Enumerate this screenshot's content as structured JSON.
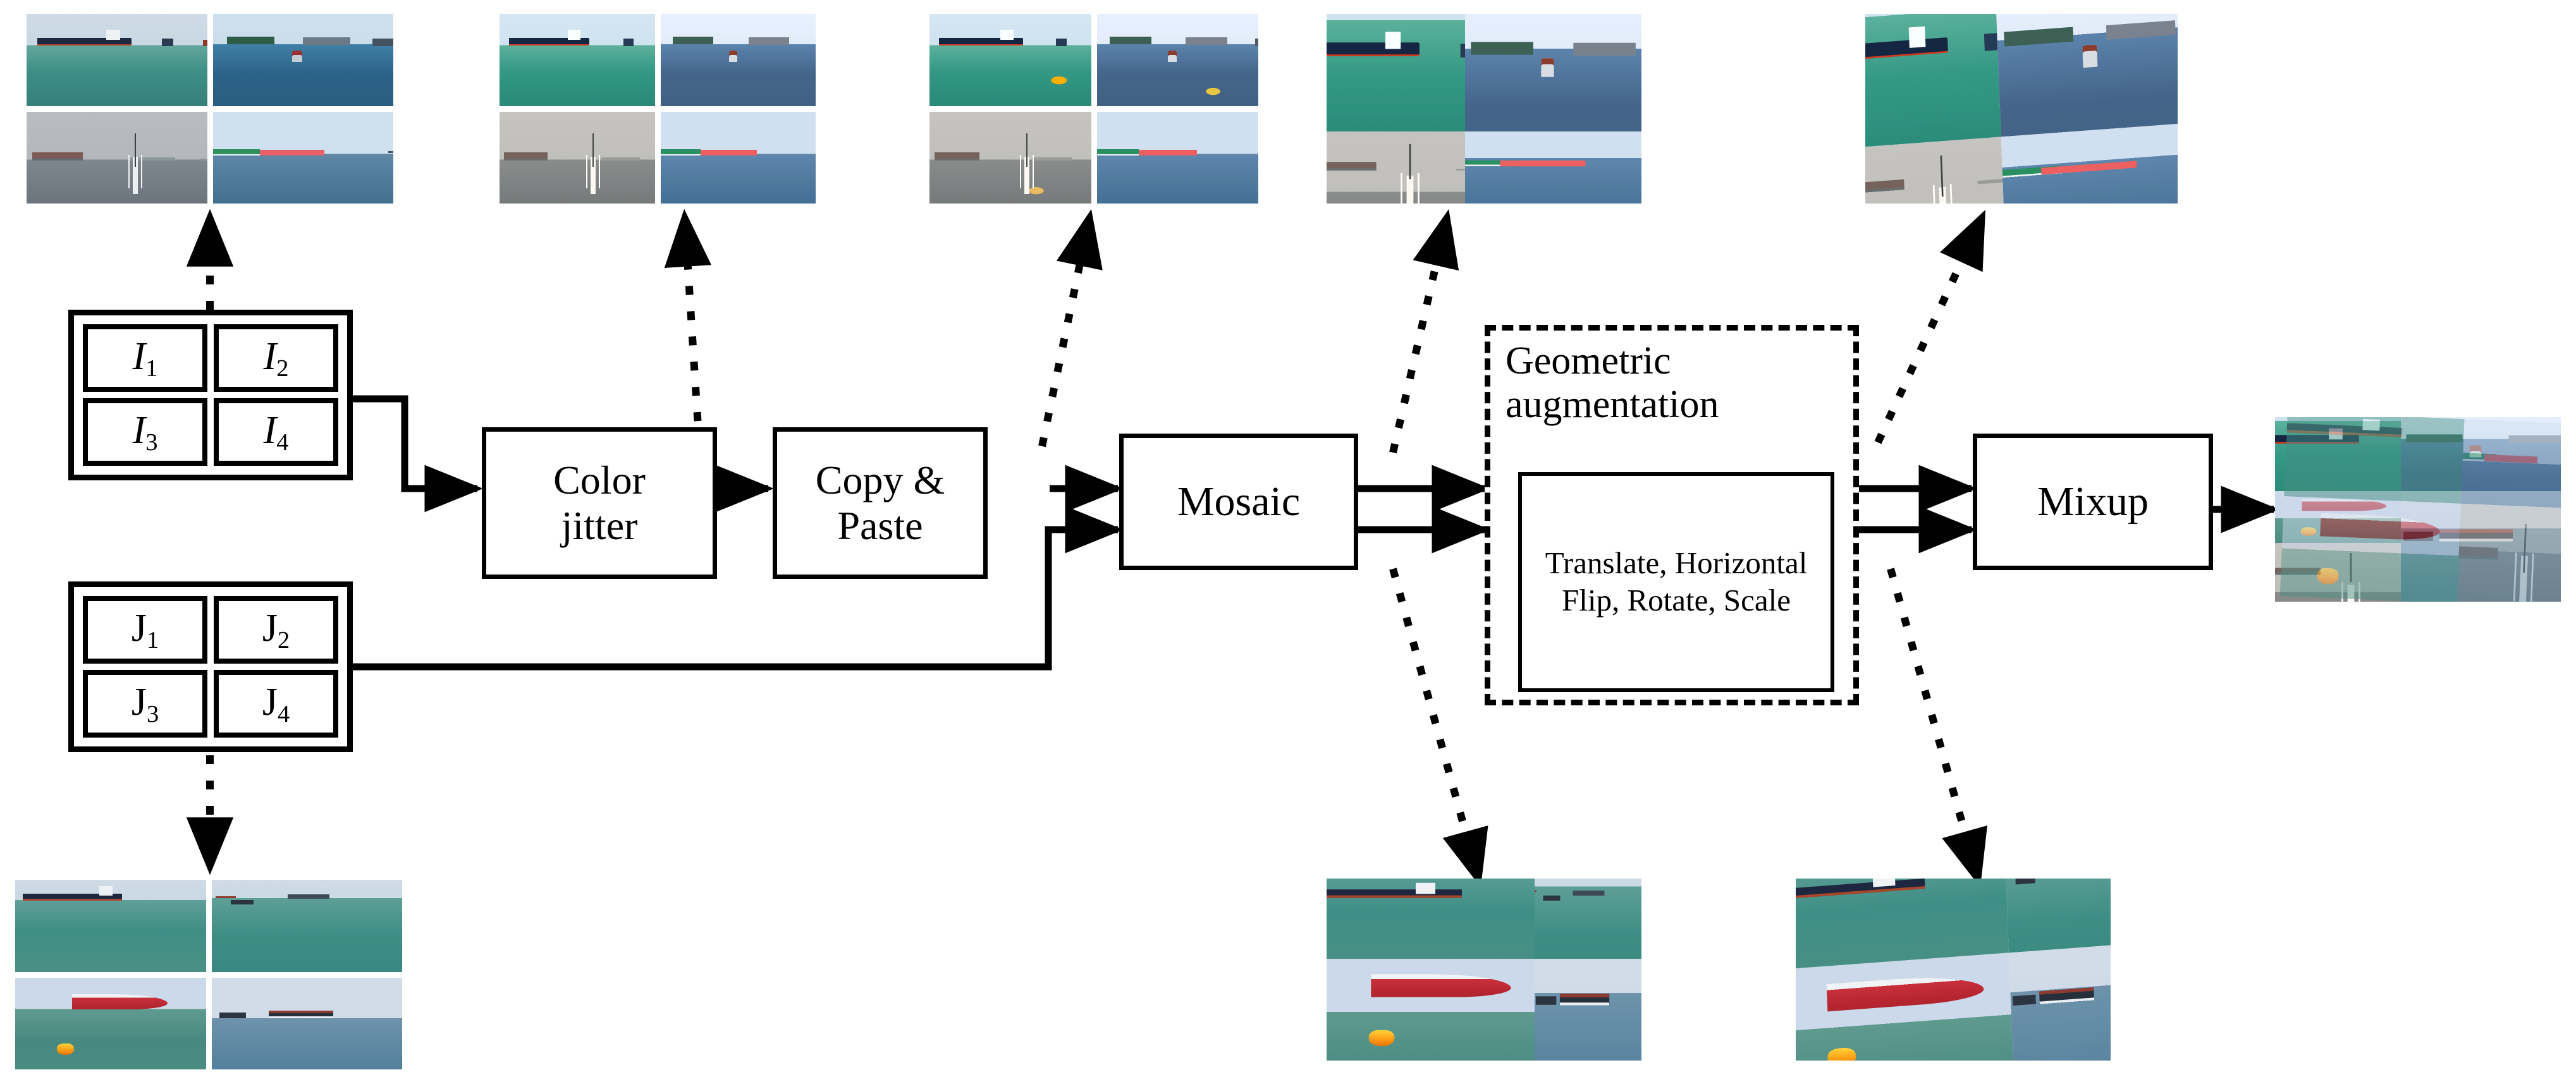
{
  "figure": {
    "type": "augmentation-pipeline-diagram",
    "title": "Data augmentation pipeline for maritime object detection"
  },
  "batches": [
    {
      "id": "batch-I",
      "name": "source-batch-I",
      "cells": [
        {
          "base": "I",
          "sub": "1",
          "italic": true
        },
        {
          "base": "I",
          "sub": "2",
          "italic": true
        },
        {
          "base": "I",
          "sub": "3",
          "italic": true
        },
        {
          "base": "I",
          "sub": "4",
          "italic": true
        }
      ]
    },
    {
      "id": "batch-J",
      "name": "source-batch-J",
      "cells": [
        {
          "base": "J",
          "sub": "1",
          "italic": false
        },
        {
          "base": "J",
          "sub": "2",
          "italic": false
        },
        {
          "base": "J",
          "sub": "3",
          "italic": false
        },
        {
          "base": "J",
          "sub": "4",
          "italic": false
        }
      ]
    }
  ],
  "stages": [
    {
      "id": "color-jitter",
      "label_lines": [
        "Color",
        "jitter"
      ]
    },
    {
      "id": "copy-paste",
      "label_lines": [
        "Copy &",
        "Paste"
      ]
    },
    {
      "id": "mosaic",
      "label_lines": [
        "Mosaic"
      ]
    },
    {
      "id": "mixup",
      "label_lines": [
        "Mixup"
      ]
    }
  ],
  "geometric_group": {
    "id": "geometric-augmentation",
    "heading_lines": [
      "Geometric",
      "augmentation"
    ],
    "operations_lines": [
      "Translate,",
      "Horizontal Flip,",
      "Rotate,",
      "Scale"
    ],
    "border_style": "dashed"
  },
  "thumbnails": [
    {
      "id": "thumb-source-I",
      "caption": "source batch I preview",
      "kind": "grid-2x2"
    },
    {
      "id": "thumb-color-jitter",
      "caption": "color jittered batch preview",
      "kind": "grid-2x2"
    },
    {
      "id": "thumb-copy-paste",
      "caption": "copy & paste batch preview",
      "kind": "grid-2x2"
    },
    {
      "id": "thumb-mosaic-I",
      "caption": "mosaic of batch I",
      "kind": "mosaic"
    },
    {
      "id": "thumb-geometric-I",
      "caption": "geometric augmented mosaic of batch I",
      "kind": "skewed-mosaic"
    },
    {
      "id": "thumb-source-J",
      "caption": "source batch J preview",
      "kind": "grid-2x2"
    },
    {
      "id": "thumb-mosaic-J",
      "caption": "mosaic of batch J",
      "kind": "mosaic"
    },
    {
      "id": "thumb-geometric-J",
      "caption": "geometric augmented mosaic of batch J",
      "kind": "skewed-mosaic"
    },
    {
      "id": "thumb-mixup-output",
      "caption": "final mixup output",
      "kind": "mixup"
    }
  ],
  "edges": [
    {
      "from": "batch-I",
      "to": "color-jitter",
      "style": "solid"
    },
    {
      "from": "color-jitter",
      "to": "copy-paste",
      "style": "solid"
    },
    {
      "from": "copy-paste",
      "to": "mosaic",
      "style": "solid"
    },
    {
      "from": "batch-J",
      "to": "mosaic",
      "style": "solid"
    },
    {
      "from": "mosaic",
      "to": "geometric-augmentation",
      "style": "solid"
    },
    {
      "from": "geometric-augmentation",
      "to": "mixup",
      "style": "solid"
    },
    {
      "from": "mixup",
      "to": "thumb-mixup-output",
      "style": "solid"
    },
    {
      "from": "batch-I",
      "to": "thumb-source-I",
      "style": "dotted"
    },
    {
      "from": "color-jitter",
      "to": "thumb-color-jitter",
      "style": "dotted"
    },
    {
      "from": "copy-paste",
      "to": "thumb-copy-paste",
      "style": "dotted"
    },
    {
      "from": "mosaic",
      "to": "thumb-mosaic-I",
      "style": "dotted"
    },
    {
      "from": "mosaic",
      "to": "thumb-mosaic-J",
      "style": "dotted"
    },
    {
      "from": "geometric-augmentation",
      "to": "thumb-geometric-I",
      "style": "dotted"
    },
    {
      "from": "geometric-augmentation",
      "to": "thumb-geometric-J",
      "style": "dotted"
    },
    {
      "from": "batch-J",
      "to": "thumb-source-J",
      "style": "dotted"
    }
  ],
  "colors": {
    "line": "#000000",
    "background": "#ffffff",
    "sea_teal": "#3f8f86",
    "sea_blue": "#4d7ea3",
    "sky_pale": "#d8e4ee",
    "sky_haze": "#b9bcc0",
    "buoy_orange": "#ff9a12",
    "hull_red": "#c8303a",
    "hull_navy": "#222b46",
    "hull_green": "#2f6b4a"
  }
}
